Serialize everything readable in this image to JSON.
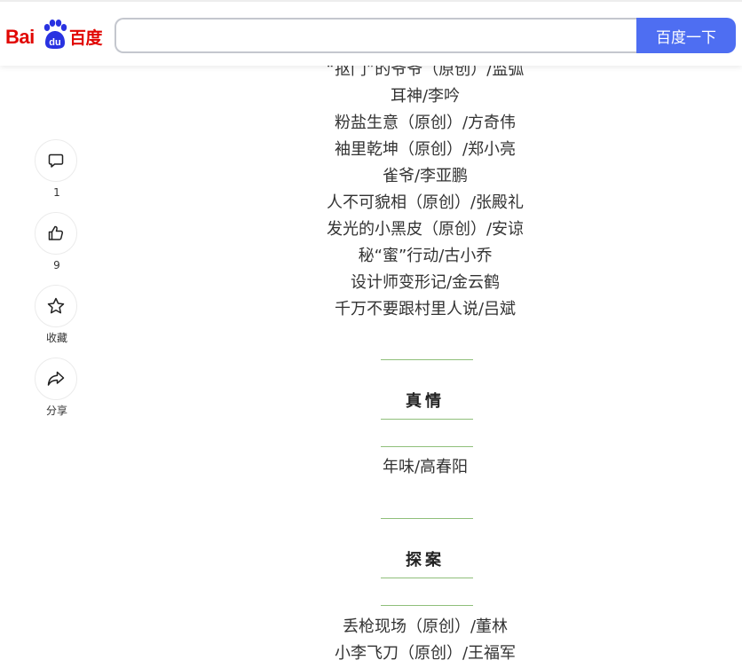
{
  "header": {
    "logo_latin": "Bai",
    "logo_du": "du",
    "logo_cn": "百度",
    "search_value": "",
    "search_button": "百度一下",
    "accent": "#4e6ef2",
    "logo_red": "#e10602",
    "logo_blue": "#2932e1"
  },
  "sidebar": {
    "comment_count": "1",
    "like_count": "9",
    "favorite_label": "收藏",
    "share_label": "分享"
  },
  "content": {
    "list1": [
      "“抠门”的爷爷（原创）/监弧",
      "耳神/李吟",
      "粉盐生意（原创）/方奇伟",
      "袖里乾坤（原创）/郑小亮",
      "雀爷/李亚鹏",
      "人不可貌相（原创）/张殿礼",
      "发光的小黑皮（原创）/安谅",
      "秘“蜜”行动/古小乔",
      "设计师变形记/金云鹤",
      "千万不要跟村里人说/吕斌"
    ],
    "section_zhenqing": "真情",
    "list2": [
      "年味/高春阳"
    ],
    "section_tanan": "探案",
    "list3": [
      "丢枪现场（原创）/董林",
      "小李飞刀（原创）/王福军"
    ],
    "divider_color": "#8fbf7a"
  }
}
